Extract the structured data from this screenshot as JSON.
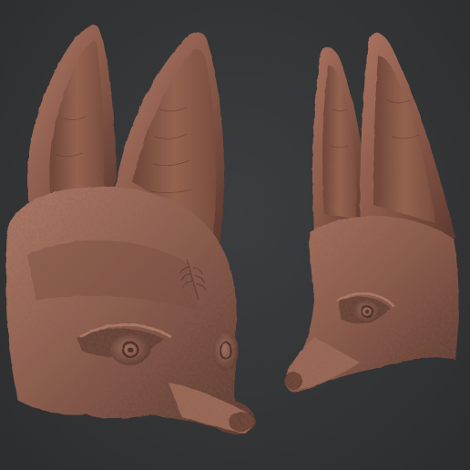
{
  "scene": {
    "description_visible_text": "",
    "background_color": "#353638",
    "clay_color": "#8a5a4b",
    "clay_highlight": "#b07a66",
    "clay_shadow": "#4e2f27",
    "clay_midtone": "#9c6957",
    "subjects": [
      {
        "name": "fennec-fox-mask-three-quarter-view"
      },
      {
        "name": "fennec-fox-mask-side-view"
      }
    ]
  }
}
